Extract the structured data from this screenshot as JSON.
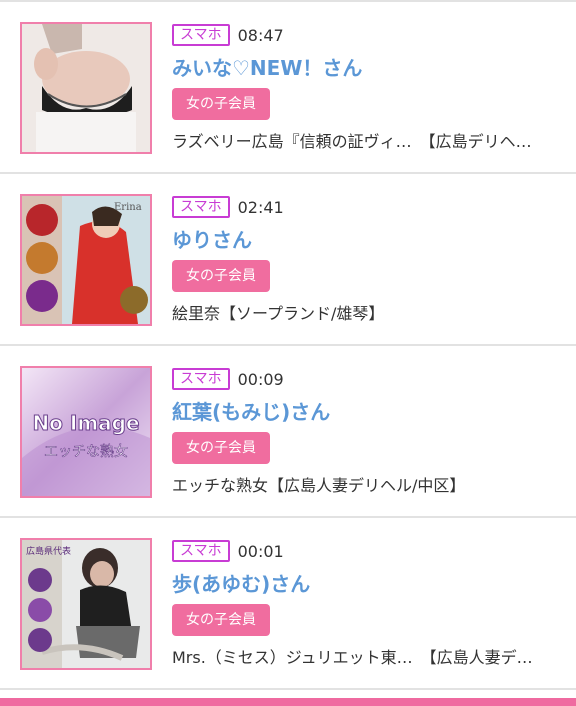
{
  "entries": [
    {
      "device": "スマホ",
      "time": "08:47",
      "name": "みいな♡NEW！さん",
      "badge": "女の子会員",
      "shop": "ラズベリー広島『信頼の証ヴィ…　【広島デリヘ…"
    },
    {
      "device": "スマホ",
      "time": "02:41",
      "name": "ゆりさん",
      "badge": "女の子会員",
      "shop": "絵里奈【ソープランド/雄琴】",
      "thumb_text": "Erina"
    },
    {
      "device": "スマホ",
      "time": "00:09",
      "name": "紅葉(もみじ)さん",
      "badge": "女の子会員",
      "shop": "エッチな熟女【広島人妻デリヘル/中区】",
      "thumb_text": "No Image",
      "thumb_subtext": "エッチな熟女"
    },
    {
      "device": "スマホ",
      "time": "00:01",
      "name": "歩(あゆむ)さん",
      "badge": "女の子会員",
      "shop": "Mrs.（ミセス）ジュリエット東…　【広島人妻デ…",
      "thumb_text": "広島県代表"
    }
  ],
  "colors": {
    "device_border": "#c83cd4",
    "name": "#5b97d6",
    "badge_bg": "#f06d9f",
    "thumb_border": "#f07fab",
    "bottom_bar": "#ef6aa0"
  }
}
